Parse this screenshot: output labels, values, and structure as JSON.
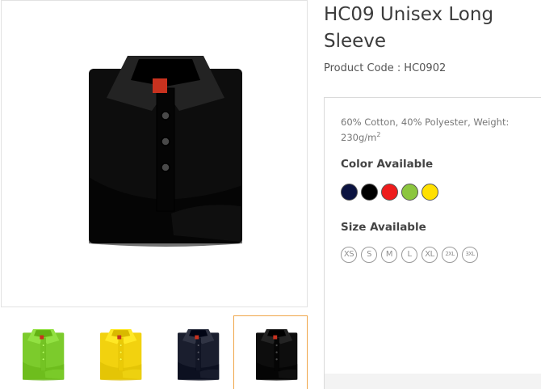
{
  "product": {
    "title": "HC09 Unisex Long Sleeve",
    "code_label": "Product Code :",
    "code_value": "HC0902",
    "description_text": "60% Cotton, 40% Polyester, Weight: 230g/m",
    "description_superscript": "2"
  },
  "main_image": {
    "alt": "black polo shirt",
    "shirt_color": "#0d0d0d",
    "tag_color": "#c8321f"
  },
  "thumbnails": [
    {
      "alt": "lime green polo shirt",
      "shirt_color": "#7ccb2c",
      "selected": false
    },
    {
      "alt": "yellow polo shirt",
      "shirt_color": "#f2d20f",
      "selected": false
    },
    {
      "alt": "navy polo shirt",
      "shirt_color": "#1a1e2e",
      "selected": false
    },
    {
      "alt": "black polo shirt",
      "shirt_color": "#0d0d0d",
      "selected": true
    }
  ],
  "colors": {
    "title": "Color Available",
    "swatches": [
      {
        "name": "navy",
        "hex": "#0b1340"
      },
      {
        "name": "black",
        "hex": "#000000"
      },
      {
        "name": "red",
        "hex": "#ee1c1c"
      },
      {
        "name": "green",
        "hex": "#8cc63e"
      },
      {
        "name": "yellow",
        "hex": "#ffe000"
      }
    ]
  },
  "sizes": {
    "title": "Size Available",
    "options": [
      "XS",
      "S",
      "M",
      "L",
      "XL",
      "2XL",
      "3XL"
    ]
  },
  "theme": {
    "selected_border": "#f0a64a",
    "panel_border": "#dadada"
  }
}
